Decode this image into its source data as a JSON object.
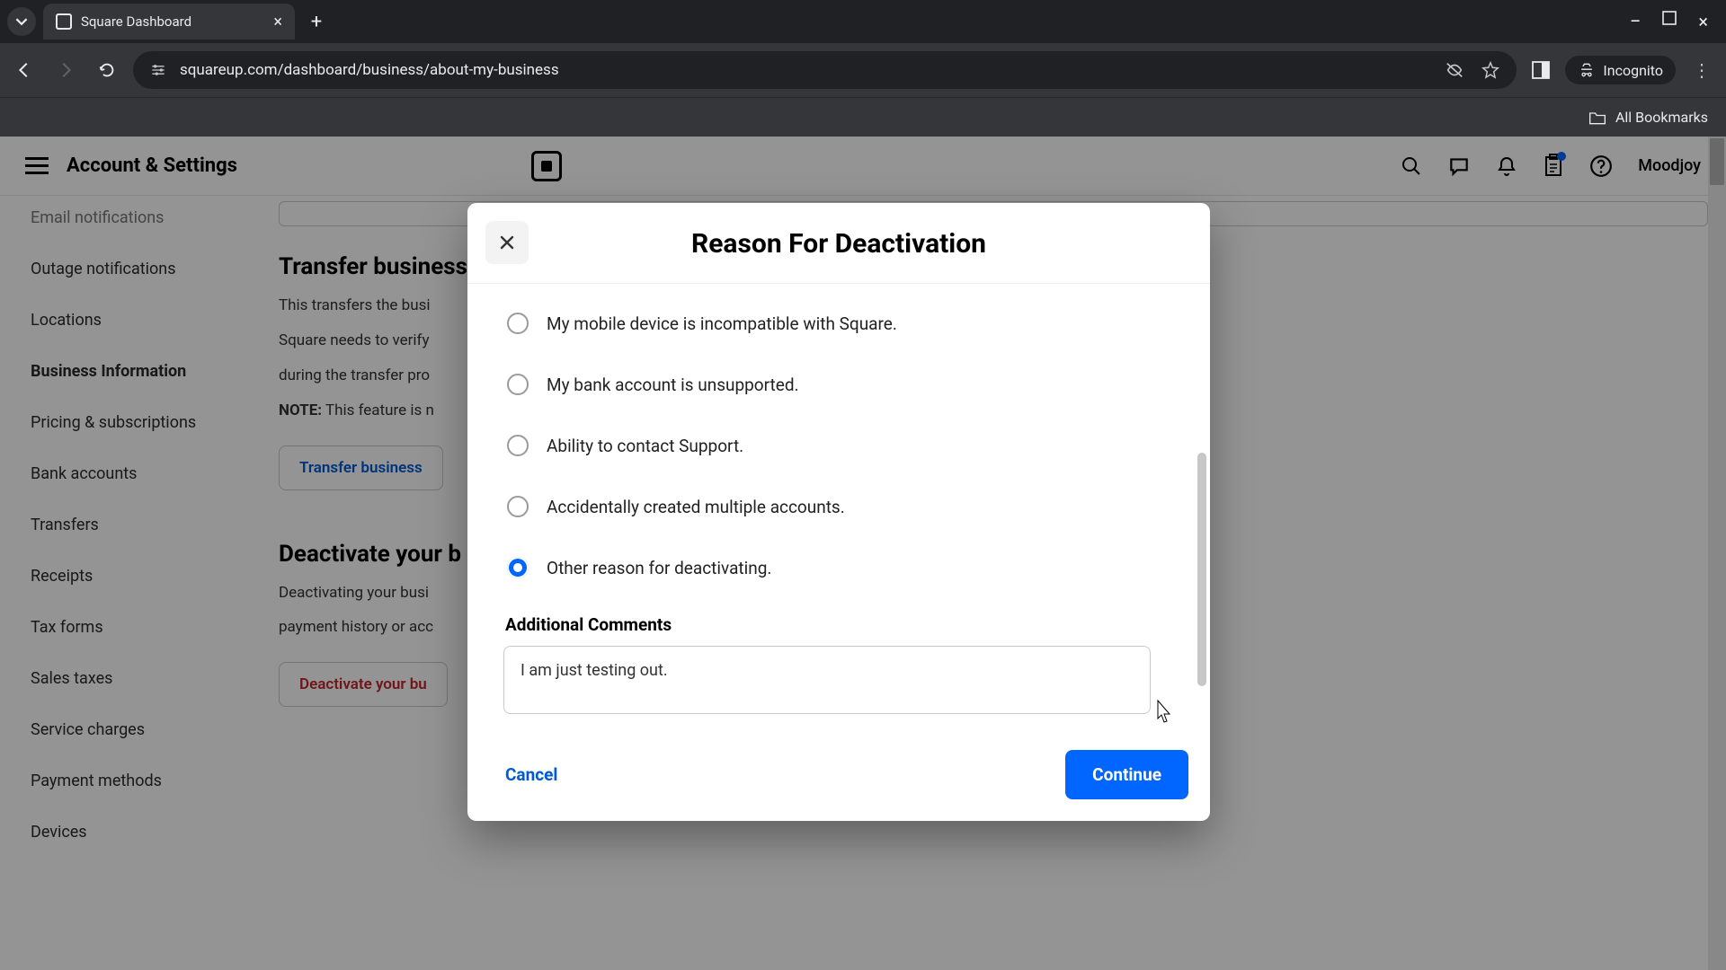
{
  "browser": {
    "tab_title": "Square Dashboard",
    "url": "squareup.com/dashboard/business/about-my-business",
    "incognito_label": "Incognito",
    "bookmarks_label": "All Bookmarks"
  },
  "topnav": {
    "page_title": "Account & Settings",
    "username": "Moodjoy"
  },
  "sidebar": {
    "items": [
      {
        "label": "Email notifications",
        "cut": true
      },
      {
        "label": "Outage notifications"
      },
      {
        "label": "Locations"
      },
      {
        "label": "Business Information",
        "selected": true
      },
      {
        "label": "Pricing & subscriptions"
      },
      {
        "label": "Bank accounts"
      },
      {
        "label": "Transfers"
      },
      {
        "label": "Receipts"
      },
      {
        "label": "Tax forms"
      },
      {
        "label": "Sales taxes"
      },
      {
        "label": "Service charges"
      },
      {
        "label": "Payment methods"
      },
      {
        "label": "Devices"
      }
    ]
  },
  "main": {
    "transfer_heading": "Transfer business",
    "transfer_body1": "This transfers the busi",
    "transfer_body2": "Square needs to verify",
    "transfer_body3": "during the transfer pro",
    "note_label": "NOTE:",
    "note_text": " This feature is n",
    "transfer_button": "Transfer business",
    "deactivate_heading": "Deactivate your b",
    "deactivate_body1": "Deactivating your busi",
    "deactivate_body2": "payment history or acc",
    "deactivate_button": "Deactivate your bu"
  },
  "modal": {
    "title": "Reason For Deactivation",
    "options": [
      {
        "label": "My mobile device is incompatible with Square.",
        "checked": false
      },
      {
        "label": "My bank account is unsupported.",
        "checked": false
      },
      {
        "label": "Ability to contact Support.",
        "checked": false
      },
      {
        "label": "Accidentally created multiple accounts.",
        "checked": false
      },
      {
        "label": "Other reason for deactivating.",
        "checked": true
      }
    ],
    "comments_label": "Additional Comments",
    "comments_value": "I am just testing out.",
    "cancel": "Cancel",
    "continue": "Continue"
  }
}
